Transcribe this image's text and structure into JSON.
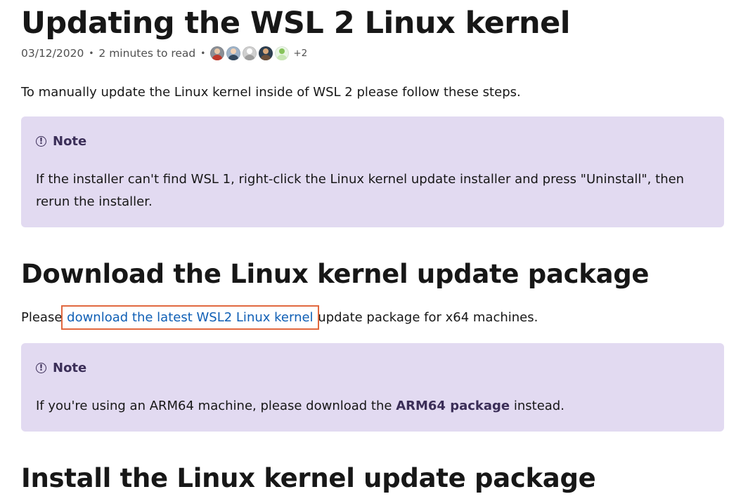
{
  "article": {
    "title": "Updating the WSL 2 Linux kernel",
    "meta": {
      "date": "03/12/2020",
      "read_time": "2 minutes to read",
      "separator": "•",
      "contributors_extra": "+2"
    },
    "intro": "To manually update the Linux kernel inside of WSL 2 please follow these steps.",
    "note1": {
      "label": "Note",
      "icon": "info-circle-icon",
      "text": "If the installer can't find WSL 1, right-click the Linux kernel update installer and press \"Uninstall\", then rerun the installer."
    },
    "section_download": {
      "heading": "Download the Linux kernel update package",
      "before_link": "Please ",
      "link_text": "download the latest WSL2 Linux kernel",
      "after_link": " update package for x64 machines."
    },
    "note2": {
      "label": "Note",
      "icon": "info-circle-icon",
      "text_before": "If you're using an ARM64 machine, please download the ",
      "bold": "ARM64 package",
      "text_after": " instead."
    },
    "section_install": {
      "heading": "Install the Linux kernel update package"
    }
  },
  "colors": {
    "link": "#0f5fb5",
    "note_bg": "#e2daf1",
    "note_accent": "#3b2e58",
    "highlight_border": "#e1683f",
    "text": "#171717",
    "meta_text": "#505050"
  },
  "avatars": [
    {
      "name": "contributor-avatar",
      "bg": "#8a8f96",
      "head": "#e8c7a8",
      "body": "#c0392b"
    },
    {
      "name": "contributor-avatar",
      "bg": "#9fb3c8",
      "head": "#f1d1b5",
      "body": "#34495e"
    },
    {
      "name": "contributor-avatar",
      "bg": "#cfcfcf",
      "head": "#ffffff",
      "body": "#9e9e9e"
    },
    {
      "name": "contributor-avatar",
      "bg": "#2c3e50",
      "head": "#d8a77a",
      "body": "#6b4f3a"
    },
    {
      "name": "contributor-avatar",
      "bg": "#e9f6e4",
      "head": "#86c35a",
      "body": "#c7e6b3"
    }
  ]
}
